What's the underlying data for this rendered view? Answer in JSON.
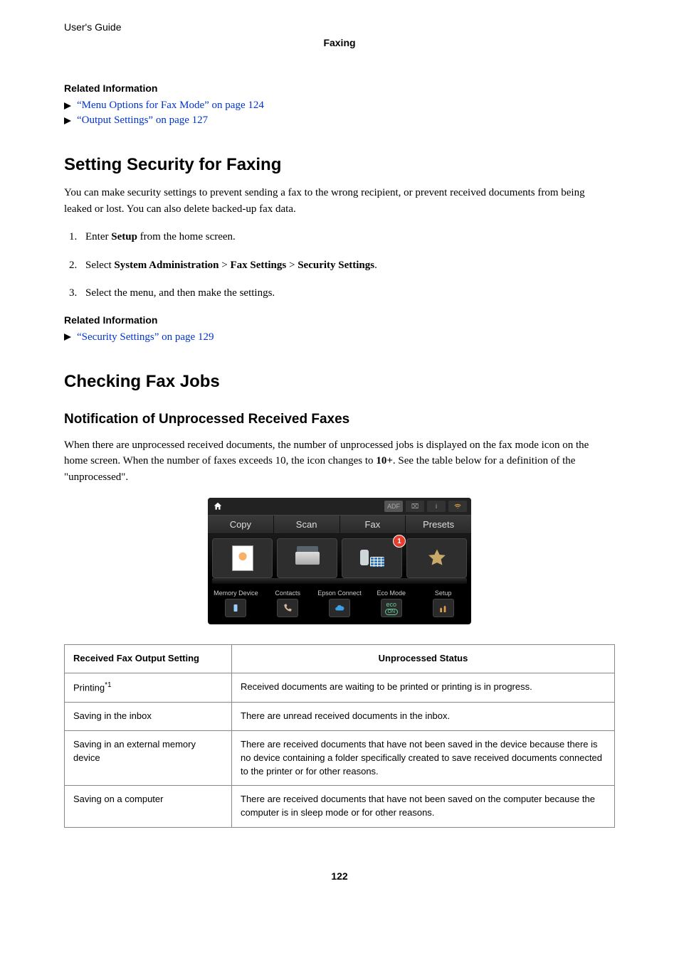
{
  "header": {
    "guide": "User's Guide",
    "section": "Faxing"
  },
  "relatedTop": {
    "heading": "Related Information",
    "links": [
      "“Menu Options for Fax Mode” on page 124",
      "“Output Settings” on page 127"
    ]
  },
  "security": {
    "heading": "Setting Security for Faxing",
    "intro": "You can make security settings to prevent sending a fax to the wrong recipient, or prevent received documents from being leaked or lost. You can also delete backed-up fax data.",
    "step1_a": "Enter ",
    "step1_b": "Setup",
    "step1_c": " from the home screen.",
    "step2_a": "Select ",
    "step2_b": "System Administration",
    "step2_gt1": " > ",
    "step2_c": "Fax Settings",
    "step2_gt2": " > ",
    "step2_d": "Security Settings",
    "step2_e": ".",
    "step3": "Select the menu, and then make the settings."
  },
  "relatedMid": {
    "heading": "Related Information",
    "links": [
      "“Security Settings” on page 129"
    ]
  },
  "check": {
    "heading": "Checking Fax Jobs",
    "subheading": "Notification of Unprocessed Received Faxes",
    "body_a": "When there are unprocessed received documents, the number of unprocessed jobs is displayed on the fax mode icon on the home screen. When the number of faxes exceeds 10, the icon changes to ",
    "body_b": "10+",
    "body_c": ". See the table below for a definition of the \"unprocessed\"."
  },
  "device": {
    "status": {
      "adf": "ADF"
    },
    "tabs": [
      "Copy",
      "Scan",
      "Fax",
      "Presets"
    ],
    "badge": "1",
    "small": [
      "Memory Device",
      "Contacts",
      "Epson Connect",
      "Eco Mode",
      "Setup"
    ],
    "eco_label": "eco",
    "eco_on": "ON"
  },
  "table": {
    "head1": "Received Fax Output Setting",
    "head2": "Unprocessed Status",
    "rows": [
      {
        "c1": "Printing",
        "c1_sup": "*1",
        "c2": "Received documents are waiting to be printed or printing is in progress."
      },
      {
        "c1": "Saving in the inbox",
        "c1_sup": "",
        "c2": "There are unread received documents in the inbox."
      },
      {
        "c1": "Saving in an external memory device",
        "c1_sup": "",
        "c2": "There are received documents that have not been saved in the device because there is no device containing a folder specifically created to save received documents connected to the printer or for other reasons."
      },
      {
        "c1": "Saving on a computer",
        "c1_sup": "",
        "c2": "There are received documents that have not been saved on the computer because the computer is in sleep mode or for other reasons."
      }
    ]
  },
  "pageNumber": "122"
}
